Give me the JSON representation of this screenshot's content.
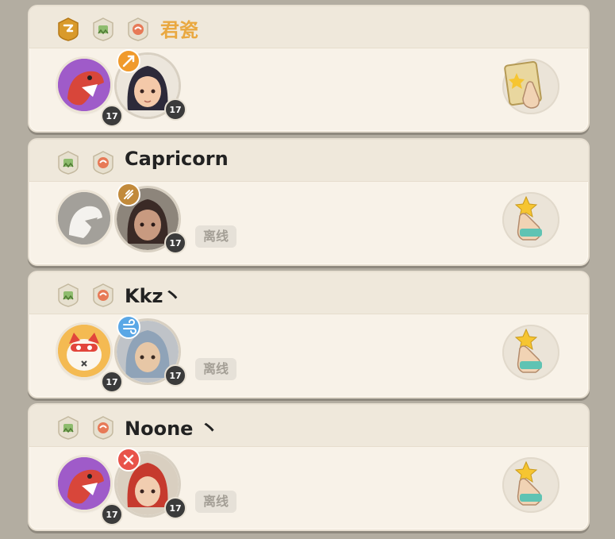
{
  "players": [
    {
      "name": "君瓷",
      "name_color": "gold",
      "badges": [
        "crown-badge",
        "squad-badge",
        "guild-badge"
      ],
      "companion_level": "17",
      "character_level": "17",
      "status": "",
      "action": "like-hand-icon"
    },
    {
      "name": "Capricorn",
      "name_color": "default",
      "badges": [
        "squad-badge",
        "guild-badge"
      ],
      "companion_level": "",
      "character_level": "17",
      "status": "离线",
      "action": "star-hand-icon"
    },
    {
      "name": "Kkz丶",
      "name_color": "default",
      "badges": [
        "squad-badge",
        "guild-badge"
      ],
      "companion_level": "17",
      "character_level": "17",
      "status": "离线",
      "action": "star-hand-icon"
    },
    {
      "name": "Noone 丶",
      "name_color": "default",
      "badges": [
        "squad-badge",
        "guild-badge"
      ],
      "companion_level": "17",
      "character_level": "17",
      "status": "离线",
      "action": "star-hand-icon"
    }
  ]
}
